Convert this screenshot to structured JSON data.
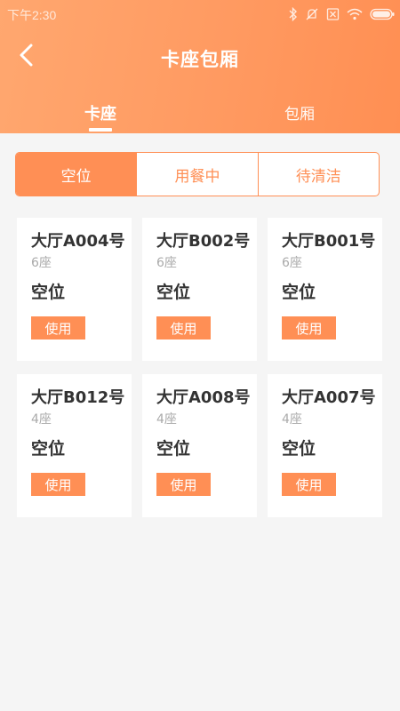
{
  "status_bar": {
    "time": "下午2:30",
    "icons": [
      "bluetooth-icon",
      "mute-icon",
      "sim-icon",
      "wifi-icon",
      "battery-icon"
    ]
  },
  "header": {
    "title": "卡座包厢",
    "back_icon": "chevron-left-icon",
    "tabs": [
      {
        "label": "卡座",
        "active": true
      },
      {
        "label": "包厢",
        "active": false
      }
    ]
  },
  "filter": {
    "options": [
      {
        "label": "空位",
        "selected": true
      },
      {
        "label": "用餐中",
        "selected": false
      },
      {
        "label": "待清洁",
        "selected": false
      }
    ]
  },
  "tables": [
    {
      "name": "大厅A004号",
      "seats": "6座",
      "status": "空位",
      "button": "使用"
    },
    {
      "name": "大厅B002号",
      "seats": "6座",
      "status": "空位",
      "button": "使用"
    },
    {
      "name": "大厅B001号",
      "seats": "6座",
      "status": "空位",
      "button": "使用"
    },
    {
      "name": "大厅B012号",
      "seats": "4座",
      "status": "空位",
      "button": "使用"
    },
    {
      "name": "大厅A008号",
      "seats": "4座",
      "status": "空位",
      "button": "使用"
    },
    {
      "name": "大厅A007号",
      "seats": "4座",
      "status": "空位",
      "button": "使用"
    }
  ],
  "colors": {
    "accent": "#ff8f55",
    "header_gradient_start": "#ffa76f",
    "header_gradient_end": "#ff8f53",
    "page_background": "#f5f5f5",
    "card_background": "#ffffff"
  }
}
